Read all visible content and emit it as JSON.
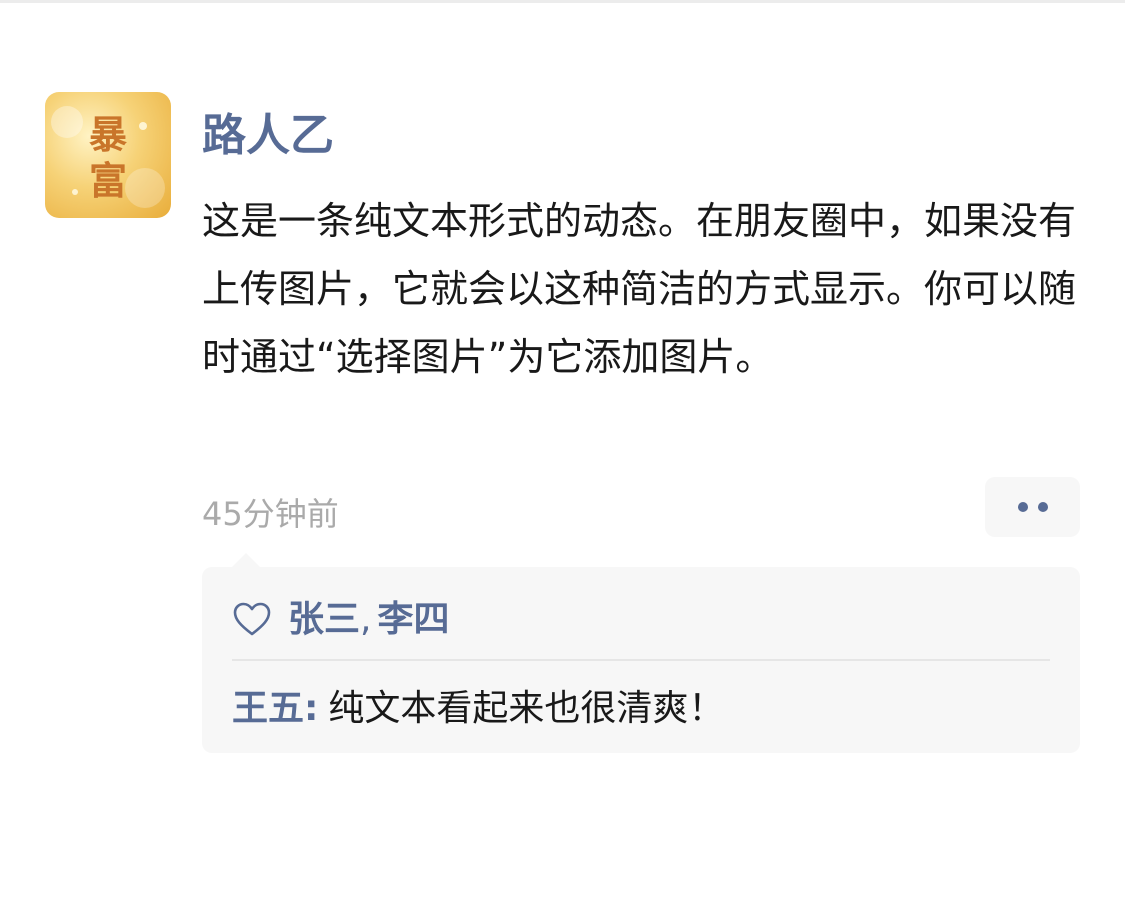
{
  "post": {
    "author": "路人乙",
    "text": "这是一条纯文本形式的动态。在朋友圈中，如果没有上传图片，它就会以这种简洁的方式显示。你可以随时通过“选择图片”为它添加图片。",
    "time": "45分钟前",
    "avatar": {
      "text": "暴富",
      "colors": [
        "#f4c95d",
        "#e9b23f",
        "#fbe6a6"
      ]
    }
  },
  "likes": {
    "names": [
      "张三",
      "李四"
    ],
    "separator": ","
  },
  "comments": [
    {
      "author": "王五:",
      "text": "纯文本看起来也很清爽！"
    }
  ],
  "colors": {
    "name": "#576b95",
    "text": "#191919",
    "time": "#aaaaaa",
    "panel_bg": "#f7f7f7"
  }
}
